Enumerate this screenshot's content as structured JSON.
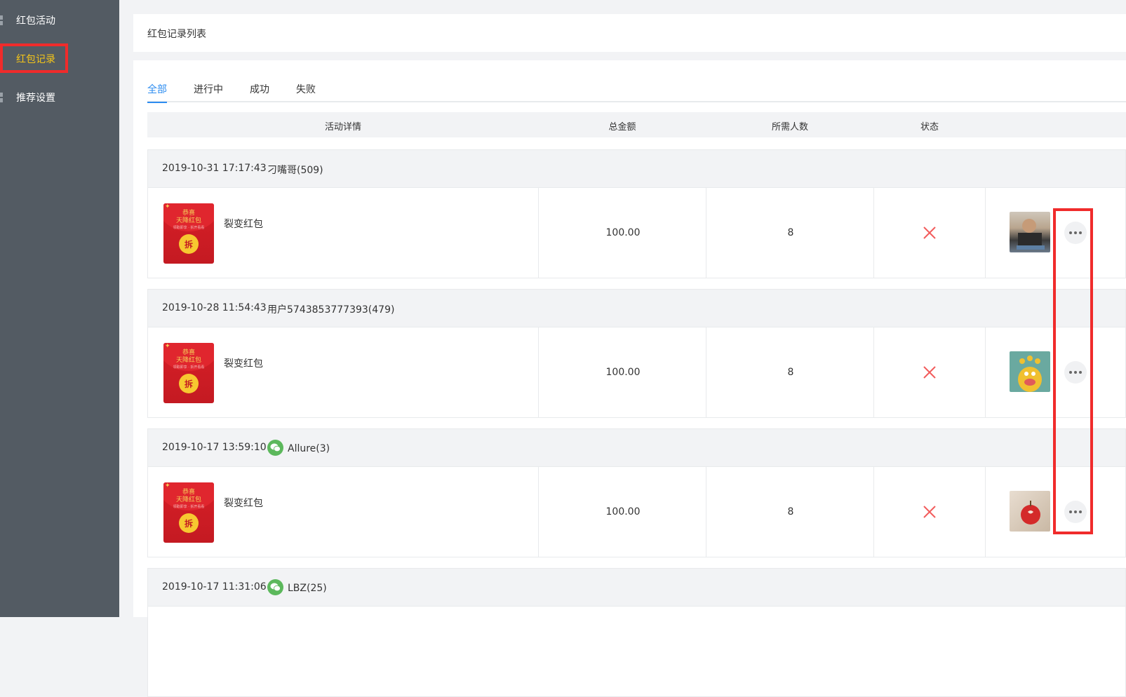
{
  "sidebar": {
    "items": [
      {
        "label": "红包活动",
        "active": false
      },
      {
        "label": "红包记录",
        "active": true
      },
      {
        "label": "推荐设置",
        "active": false
      }
    ]
  },
  "header": {
    "title": "红包记录列表"
  },
  "tabs": [
    {
      "label": "全部",
      "active": true
    },
    {
      "label": "进行中",
      "active": false
    },
    {
      "label": "成功",
      "active": false
    },
    {
      "label": "失败",
      "active": false
    }
  ],
  "table": {
    "columns": [
      "活动详情",
      "总金额",
      "所需人数",
      "状态"
    ]
  },
  "envelope": {
    "line1": "恭喜",
    "line2": "天降红包",
    "line3": "领取即享 · 拆开看看",
    "coin": "拆"
  },
  "records": [
    {
      "time": "2019-10-31 17:17:43",
      "user": "刁嘴哥(509)",
      "wechat": false,
      "activity": "裂变红包",
      "amount": "100.00",
      "people": "8",
      "status": "failed",
      "avatar": "man-photo"
    },
    {
      "time": "2019-10-28 11:54:43",
      "user": "用户5743853777393(479)",
      "wechat": false,
      "activity": "裂变红包",
      "amount": "100.00",
      "people": "8",
      "status": "failed",
      "avatar": "monster-cartoon"
    },
    {
      "time": "2019-10-17 13:59:10",
      "user": "Allure(3)",
      "wechat": true,
      "activity": "裂变红包",
      "amount": "100.00",
      "people": "8",
      "status": "failed",
      "avatar": "apple-photo"
    },
    {
      "time": "2019-10-17 11:31:06",
      "user": "LBZ(25)",
      "wechat": true
    }
  ],
  "colors": {
    "sidebar_bg": "#535b63",
    "active": "#f5c518",
    "accent": "#2d8cf0",
    "highlight": "#f02b2b",
    "fail": "#f25c5c"
  }
}
